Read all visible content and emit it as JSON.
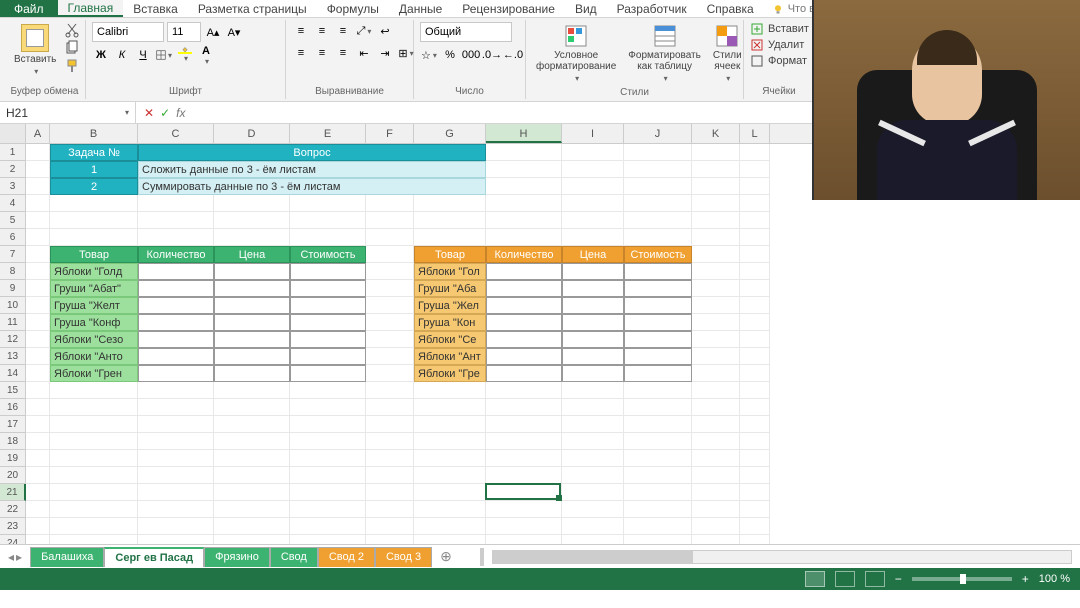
{
  "tabs": {
    "file": "Файл",
    "home": "Главная",
    "insert": "Вставка",
    "layout": "Разметка страницы",
    "formulas": "Формулы",
    "data": "Данные",
    "review": "Рецензирование",
    "view": "Вид",
    "developer": "Разработчик",
    "help": "Справка",
    "tellme": "Что вы хотите сдел"
  },
  "ribbon": {
    "clipboard": {
      "paste": "Вставить",
      "label": "Буфер обмена"
    },
    "font": {
      "name": "Calibri",
      "size": "11",
      "label": "Шрифт",
      "bold": "Ж",
      "italic": "К",
      "underline": "Ч"
    },
    "alignment": {
      "label": "Выравнивание"
    },
    "number": {
      "format": "Общий",
      "label": "Число"
    },
    "styles": {
      "cond": "Условное форматирование",
      "table": "Форматировать как таблицу",
      "cell": "Стили ячеек",
      "label": "Стили"
    },
    "cells": {
      "insert": "Вставит",
      "delete": "Удалит",
      "format": "Формат",
      "label": "Ячейки"
    }
  },
  "namebox": "H21",
  "columns": [
    "A",
    "B",
    "C",
    "D",
    "E",
    "F",
    "G",
    "H",
    "I",
    "J",
    "K",
    "L"
  ],
  "task_header": {
    "num": "Задача №",
    "q": "Вопрос"
  },
  "tasks": [
    {
      "n": "1",
      "q": "Сложить данные по 3 - ём листам"
    },
    {
      "n": "2",
      "q": "Суммировать данные по 3 - ём листам"
    }
  ],
  "tbl_headers": {
    "product": "Товар",
    "qty": "Количество",
    "price": "Цена",
    "cost": "Стоимость"
  },
  "green_items": [
    "Яблоки \"Голд",
    "Груши \"Абат\"",
    "Груша \"Желт",
    "Груша \"Конф",
    "Яблоки \"Сезо",
    "Яблоки \"Анто",
    "Яблоки \"Грен"
  ],
  "orange_items": [
    "Яблоки \"Гол",
    "Груши \"Аба",
    "Груша \"Жел",
    "Груша \"Кон",
    "Яблоки \"Се",
    "Яблоки \"Ант",
    "Яблоки \"Гре"
  ],
  "sheets": [
    "Балашиха",
    "Серг ев Пасад",
    "Фрязино",
    "Свод",
    "Свод 2",
    "Свод 3"
  ],
  "zoom": "100 %"
}
